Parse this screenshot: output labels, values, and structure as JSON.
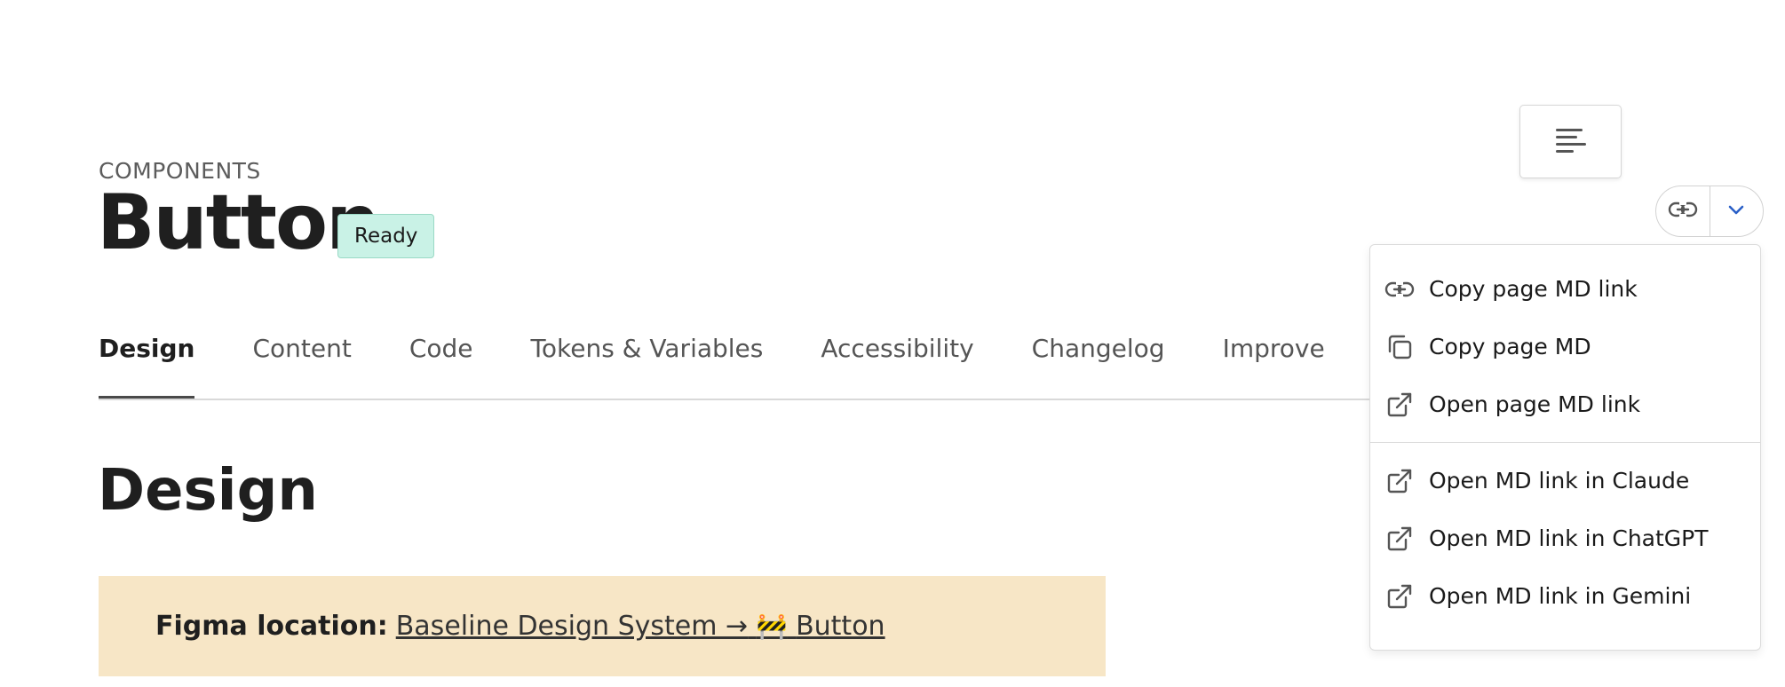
{
  "header": {
    "eyebrow": "COMPONENTS",
    "title": "Button",
    "status": "Ready"
  },
  "tabs": [
    {
      "label": "Design",
      "active": true
    },
    {
      "label": "Content"
    },
    {
      "label": "Code"
    },
    {
      "label": "Tokens & Variables"
    },
    {
      "label": "Accessibility"
    },
    {
      "label": "Changelog"
    },
    {
      "label": "Improve"
    }
  ],
  "section": {
    "heading": "Design"
  },
  "figma": {
    "label": "Figma location:",
    "link_path": "Baseline Design System →",
    "link_emoji": "🚧",
    "link_target": "Button"
  },
  "toolbar": {
    "toc_icon": "align-left-icon",
    "copy_link_icon": "link-icon",
    "dropdown_icon": "chevron-down-icon"
  },
  "md_menu": {
    "groups": [
      [
        {
          "label": "Copy page MD link",
          "icon": "link-icon"
        },
        {
          "label": "Copy page MD",
          "icon": "copy-icon"
        },
        {
          "label": "Open page MD link",
          "icon": "external-link-icon"
        }
      ],
      [
        {
          "label": "Open MD link in Claude",
          "icon": "external-link-icon"
        },
        {
          "label": "Open MD link in ChatGPT",
          "icon": "external-link-icon"
        },
        {
          "label": "Open MD link in Gemini",
          "icon": "external-link-icon"
        }
      ]
    ]
  },
  "colors": {
    "status_badge_bg": "#c9f2e6",
    "callout_bg": "#f7e6c6",
    "chevron_accent": "#2a5fc7",
    "text_primary": "#1f1f1f"
  }
}
